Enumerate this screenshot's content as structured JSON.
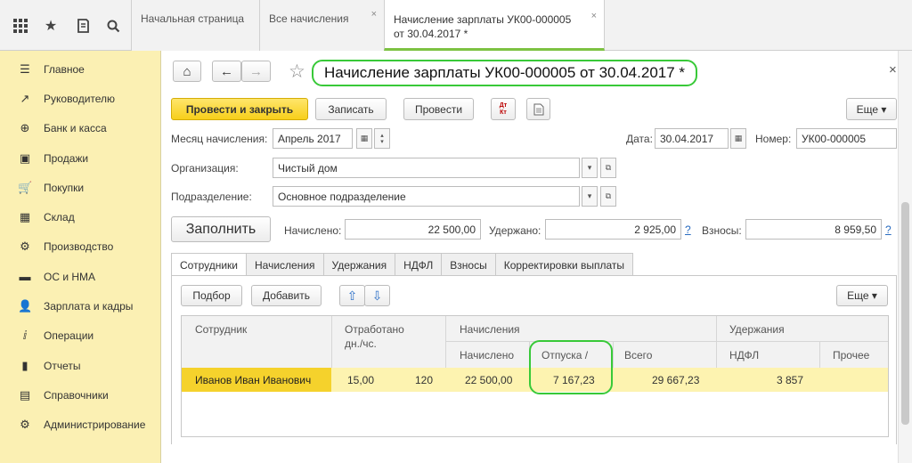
{
  "toolbar_icons": [
    "apps-grid-icon",
    "star-icon",
    "history-icon",
    "search-icon"
  ],
  "tabs": [
    {
      "label": "Начальная страница"
    },
    {
      "label": "Все начисления",
      "close": "×"
    },
    {
      "label_line1": "Начисление зарплаты УК00-000005",
      "label_line2": "от 30.04.2017 *",
      "close": "×"
    }
  ],
  "sidebar": {
    "items": [
      {
        "label": "Главное",
        "icon": "☰"
      },
      {
        "label": "Руководителю",
        "icon": "↗"
      },
      {
        "label": "Банк и касса",
        "icon": "⊕"
      },
      {
        "label": "Продажи",
        "icon": "▣"
      },
      {
        "label": "Покупки",
        "icon": "🛒"
      },
      {
        "label": "Склад",
        "icon": "▦"
      },
      {
        "label": "Производство",
        "icon": "⚙"
      },
      {
        "label": "ОС и НМА",
        "icon": "▬"
      },
      {
        "label": "Зарплата и кадры",
        "icon": "👤"
      },
      {
        "label": "Операции",
        "icon": "ⅈ"
      },
      {
        "label": "Отчеты",
        "icon": "▮"
      },
      {
        "label": "Справочники",
        "icon": "▤"
      },
      {
        "label": "Администрирование",
        "icon": "⚙"
      }
    ]
  },
  "doc": {
    "title": "Начисление зарплаты УК00-000005 от 30.04.2017 *",
    "close": "×",
    "nav": {
      "home": "⌂",
      "back": "←",
      "forward": "→",
      "star": "☆"
    },
    "buttons": {
      "post_close": "Провести и закрыть",
      "save": "Записать",
      "post": "Провести",
      "dt_kt": "Дт Кт",
      "more": "Еще ▾"
    },
    "month_label": "Месяц начисления:",
    "month_value": "Апрель 2017",
    "date_label": "Дата:",
    "date_value": "30.04.2017",
    "number_label": "Номер:",
    "number_value": "УК00-000005",
    "org_label": "Организация:",
    "org_value": "Чистый дом",
    "dept_label": "Подразделение:",
    "dept_value": "Основное подразделение",
    "fill_button": "Заполнить",
    "accrued_label": "Начислено:",
    "accrued_value": "22 500,00",
    "withheld_label": "Удержано:",
    "withheld_value": "2 925,00",
    "contrib_label": "Взносы:",
    "contrib_value": "8 959,50",
    "help": "?"
  },
  "form_tabs": [
    "Сотрудники",
    "Начисления",
    "Удержания",
    "НДФЛ",
    "Взносы",
    "Корректировки выплаты"
  ],
  "table_toolbar": {
    "select": "Подбор",
    "add": "Добавить",
    "up": "⇧",
    "down": "⇩",
    "more": "Еще ▾"
  },
  "table": {
    "headers": {
      "employee": "Сотрудник",
      "worked": "Отработано",
      "worked_sub": "дн./чс.",
      "accruals": "Начисления",
      "accrued": "Начислено",
      "vacation": "Отпуска /",
      "total": "Всего",
      "deductions": "Удержания",
      "ndfl": "НДФЛ",
      "other": "Прочее"
    },
    "rows": [
      {
        "employee": "Иванов Иван Иванович",
        "days": "15,00",
        "hours": "120",
        "accrued": "22 500,00",
        "vacation": "7 167,23",
        "total": "29 667,23",
        "ndfl": "3 857",
        "other": ""
      }
    ]
  }
}
